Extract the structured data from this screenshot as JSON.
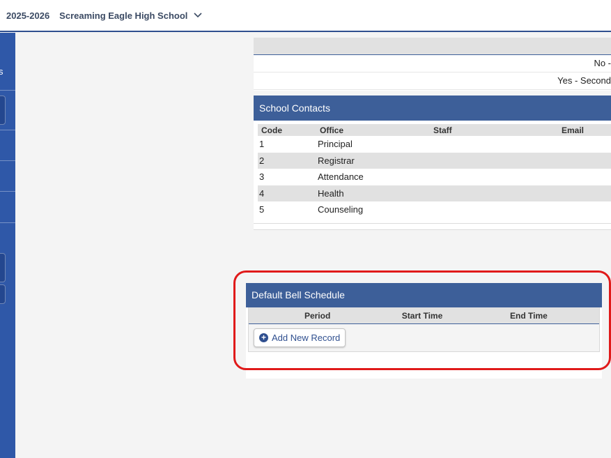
{
  "header": {
    "school_year": "2025-2026",
    "school_name": "Screaming Eagle High School"
  },
  "sidebar": {
    "partial_label": "s"
  },
  "top_table": {
    "rows": [
      "No -",
      "Yes - Second"
    ]
  },
  "contacts": {
    "title": "School Contacts",
    "columns": [
      "Code",
      "Office",
      "Staff",
      "Email"
    ],
    "rows": [
      {
        "code": "1",
        "office": "Principal"
      },
      {
        "code": "2",
        "office": "Registrar"
      },
      {
        "code": "3",
        "office": "Attendance"
      },
      {
        "code": "4",
        "office": "Health"
      },
      {
        "code": "5",
        "office": "Counseling"
      }
    ]
  },
  "bell_schedule": {
    "title": "Default Bell Schedule",
    "columns": [
      "Period",
      "Start Time",
      "End Time"
    ],
    "add_label": "Add New Record"
  },
  "colors": {
    "panel_header": "#3d5f99",
    "sidebar": "#2f58a8",
    "highlight": "#e01a1a"
  }
}
